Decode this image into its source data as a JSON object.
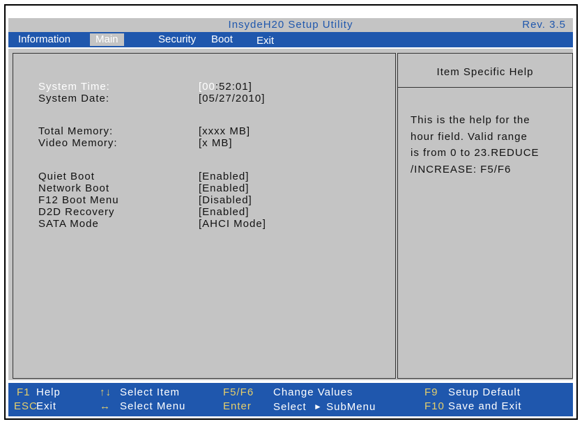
{
  "header": {
    "title": "InsydeH20 Setup Utility",
    "revision": "Rev. 3.5"
  },
  "tabs": [
    {
      "label": "Information",
      "active": false
    },
    {
      "label": "Main",
      "active": true
    },
    {
      "label": "Security",
      "active": false
    },
    {
      "label": "Boot",
      "active": false
    },
    {
      "label": "Exit",
      "active": false
    }
  ],
  "settings": {
    "system_time": {
      "label": "System Time:",
      "bracket_open": "[",
      "hours": "00",
      "rest": ":52:01]"
    },
    "system_date": {
      "label": "System Date:",
      "value": "[05/27/2010]"
    },
    "total_memory": {
      "label": "Total Memory:",
      "value": "[xxxx MB]"
    },
    "video_memory": {
      "label": "Video Memory:",
      "value": "[x MB]"
    },
    "quiet_boot": {
      "label": "Quiet Boot",
      "value": "[Enabled]"
    },
    "network_boot": {
      "label": "Network Boot",
      "value": "[Enabled]"
    },
    "f12_boot_menu": {
      "label": "F12 Boot Menu",
      "value": "[Disabled]"
    },
    "d2d_recovery": {
      "label": "D2D Recovery",
      "value": "[Enabled]"
    },
    "sata_mode": {
      "label": "SATA Mode",
      "value": "[AHCI Mode]"
    }
  },
  "help": {
    "title": "Item Specific Help",
    "lines": [
      "This is the help for the",
      "hour field. Valid range",
      "is from 0 to 23.REDUCE",
      "/INCREASE: F5/F6"
    ]
  },
  "footer": {
    "f1_key": "F1",
    "f1_action": "Help",
    "esc_key": "ESC",
    "esc_action": "Exit",
    "updown_glyph": "↑↓",
    "select_item": "Select  Item",
    "leftright_glyph": "↔",
    "select_menu": "Select  Menu",
    "f5f6_key": "F5/F6",
    "change_values": "Change  Values",
    "enter_key": "Enter",
    "select_label": "Select",
    "submenu_glyph": "►",
    "submenu_label": "SubMenu",
    "f9_key": "F9",
    "setup_default": "Setup  Default",
    "f10_key": "F10",
    "save_exit": "Save  and  Exit"
  },
  "colors": {
    "blue": "#1f57ad",
    "gray": "#c4c4c4",
    "yellow": "#e5cf6b"
  }
}
